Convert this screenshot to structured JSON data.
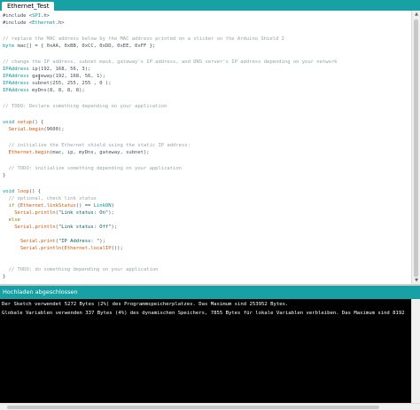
{
  "tab": {
    "label": "Ethernet_Test"
  },
  "code": {
    "l1": {
      "a": "#include <",
      "b": "SPI",
      "c": ".h>"
    },
    "l2": {
      "a": "#include <",
      "b": "Ethernet",
      "c": ".h>"
    },
    "l4": "// replace the MAC address below by the MAC address printed on a sticker on the Arduino Shield 2",
    "l5": {
      "a": "byte",
      "b": " mac[] = { 0xAA, 0xBB, 0xCC, 0xDD, 0xEE, 0xFF };"
    },
    "l7": "// change the IP address, subnet mask, gateway's IP address, and DNS server's IP address depending on your network",
    "l8": {
      "a": "IPAddress",
      "b": " ip(192, 168, 56, 3);"
    },
    "l9": {
      "a": "IPAddress",
      "b": " gateway(192, 168, 56, 1);"
    },
    "l10": {
      "a": "IPAddress",
      "b": " subnet(255, 255, 255 , 0 );"
    },
    "l11": {
      "a": "IPAddress",
      "b": " myDns(8, 8, 8, 8);"
    },
    "l13": "// TODO: Declare something depending on your application",
    "l15": {
      "a": "void",
      "b": " ",
      "c": "setup",
      "d": "() {"
    },
    "l16": {
      "a": "  ",
      "b": "Serial",
      "c": ".",
      "d": "begin",
      "e": "(9600);"
    },
    "l18": "  // initialize the Ethernet shield using the static IP address:",
    "l19": {
      "a": "  ",
      "b": "Ethernet",
      "c": ".",
      "d": "begin",
      "e": "(mac, ip, myDns, gateway, subnet);"
    },
    "l21": "  // TODO: initialize something depending on your application",
    "l22": "}",
    "l24": {
      "a": "void",
      "b": " ",
      "c": "loop",
      "d": "() {"
    },
    "l25": "  // optional, check link status",
    "l26": {
      "a": "  ",
      "b": "if",
      "c": " (",
      "d": "Ethernet",
      "e": ".",
      "f": "linkStatus",
      "g": "() == ",
      "h": "LinkON",
      "i": ")"
    },
    "l27": {
      "a": "    ",
      "b": "Serial",
      "c": ".",
      "d": "println",
      "e": "(",
      "f": "\"Link status: On\"",
      "g": ");"
    },
    "l28": {
      "a": "  ",
      "b": "else"
    },
    "l29": {
      "a": "    ",
      "b": "Serial",
      "c": ".",
      "d": "println",
      "e": "(",
      "f": "\"Link status: Off\"",
      "g": ");"
    },
    "l31": {
      "a": "      ",
      "b": "Serial",
      "c": ".",
      "d": "print",
      "e": "(",
      "f": "\"IP Address: \"",
      "g": ");"
    },
    "l32": {
      "a": "      ",
      "b": "Serial",
      "c": ".",
      "d": "println",
      "e": "(",
      "f": "Ethernet",
      "g": ".",
      "h": "localIP",
      "i": "());"
    },
    "l35": "  // TODO: do something depending on your application",
    "l36": "}"
  },
  "status": {
    "text": "Hochladen abgeschlossen"
  },
  "console": {
    "line1": "Der Sketch verwendet 5272 Bytes (2%) des Programmspeicherplatzes. Das Maximum sind 253952 Bytes.",
    "line2": "Globale Variablen verwenden 337 Bytes (4%) des dynamischen Speichers, 7855 Bytes für lokale Variablen verbleiben. Das Maximum sind 8192"
  },
  "icons": {
    "scroll_up": "chevron-up-icon",
    "scroll_down": "chevron-down-icon",
    "text_cursor": "i-beam-cursor-icon"
  },
  "colors": {
    "accent_teal": "#17a1a5",
    "comment": "#95a5a6",
    "type": "#00979c",
    "function": "#d35400",
    "keyword": "#728e00",
    "console_bg": "#000000"
  }
}
